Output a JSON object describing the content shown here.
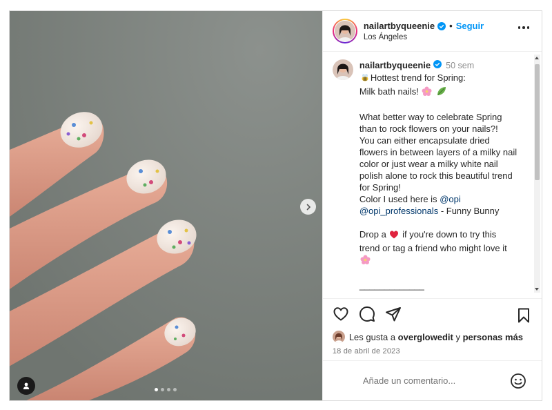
{
  "post": {
    "username": "nailartbyqueenie",
    "follow_label": "Seguir",
    "location": "Los Ángeles",
    "separator": "•"
  },
  "media": {
    "carousel_dots": 4,
    "active_dot": 0,
    "icons": {
      "next": "chevron-right-icon",
      "tagged_user": "user-icon"
    }
  },
  "caption": {
    "username": "nailartbyqueenie",
    "time_ago": "50 sem",
    "l1": "Hottest trend for Spring:",
    "l2": "Milk bath nails!",
    "l4": "What better way to celebrate Spring",
    "l5": "than to rock flowers on your nails?!",
    "l6": "You can either encapsulate dried",
    "l7": "flowers in between layers of a milky nail",
    "l8": "color or just wear a milky white nail",
    "l9": "polish alone to rock this beautiful trend",
    "l10": "for Spring!",
    "l11": "Color I used here is",
    "mention1": "@opi",
    "mention2": "@opi_professionals",
    "l12_suffix": " - Funny Bunny",
    "l14_pre": "Drop a",
    "l14_post": "if you're down to try this",
    "l15": "trend or tag a friend who might love it",
    "rule": "_____________"
  },
  "actions": {
    "icons": [
      "heart-icon",
      "comment-icon",
      "share-icon",
      "bookmark-icon"
    ]
  },
  "likes": {
    "prefix": "Les gusta a",
    "user": "overglowedit",
    "middle": "y",
    "others": "personas más"
  },
  "date": "18 de abril de 2023",
  "comment_box": {
    "placeholder": "Añade un comentario..."
  },
  "colors": {
    "accent": "#0095f6",
    "verified": "#0095f6",
    "text": "#262626",
    "muted": "#8e8e8e",
    "mention": "#00376b"
  }
}
